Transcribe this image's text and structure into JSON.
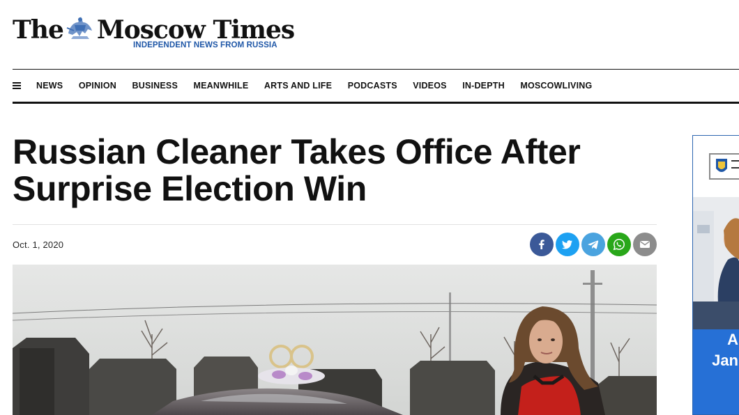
{
  "brand": {
    "name_left": "The",
    "name_right": "Moscow Times",
    "tagline": "INDEPENDENT NEWS FROM RUSSIA",
    "emblem_icon": "st-george-emblem-icon",
    "accent_color": "#1f57a7"
  },
  "nav": {
    "menu_icon": "hamburger-icon",
    "items": [
      "NEWS",
      "OPINION",
      "BUSINESS",
      "MEANWHILE",
      "ARTS AND LIFE",
      "PODCASTS",
      "VIDEOS",
      "IN-DEPTH",
      "MOSCOWLIVING"
    ]
  },
  "article": {
    "headline": "Russian Cleaner Takes Office After Surprise Election Win",
    "date": "Oct. 1, 2020",
    "share": [
      {
        "icon": "facebook-icon",
        "color": "#3b5998"
      },
      {
        "icon": "twitter-icon",
        "color": "#1da1f2"
      },
      {
        "icon": "telegram-icon",
        "color": "#4aa3df"
      },
      {
        "icon": "whatsapp-icon",
        "color": "#29a71a"
      },
      {
        "icon": "email-icon",
        "color": "#8c8c8c"
      }
    ],
    "photo_icon": "article-photo"
  },
  "sidebar_ad": {
    "text_lines": [
      "A",
      "Jan"
    ],
    "color": "#2670d6"
  }
}
